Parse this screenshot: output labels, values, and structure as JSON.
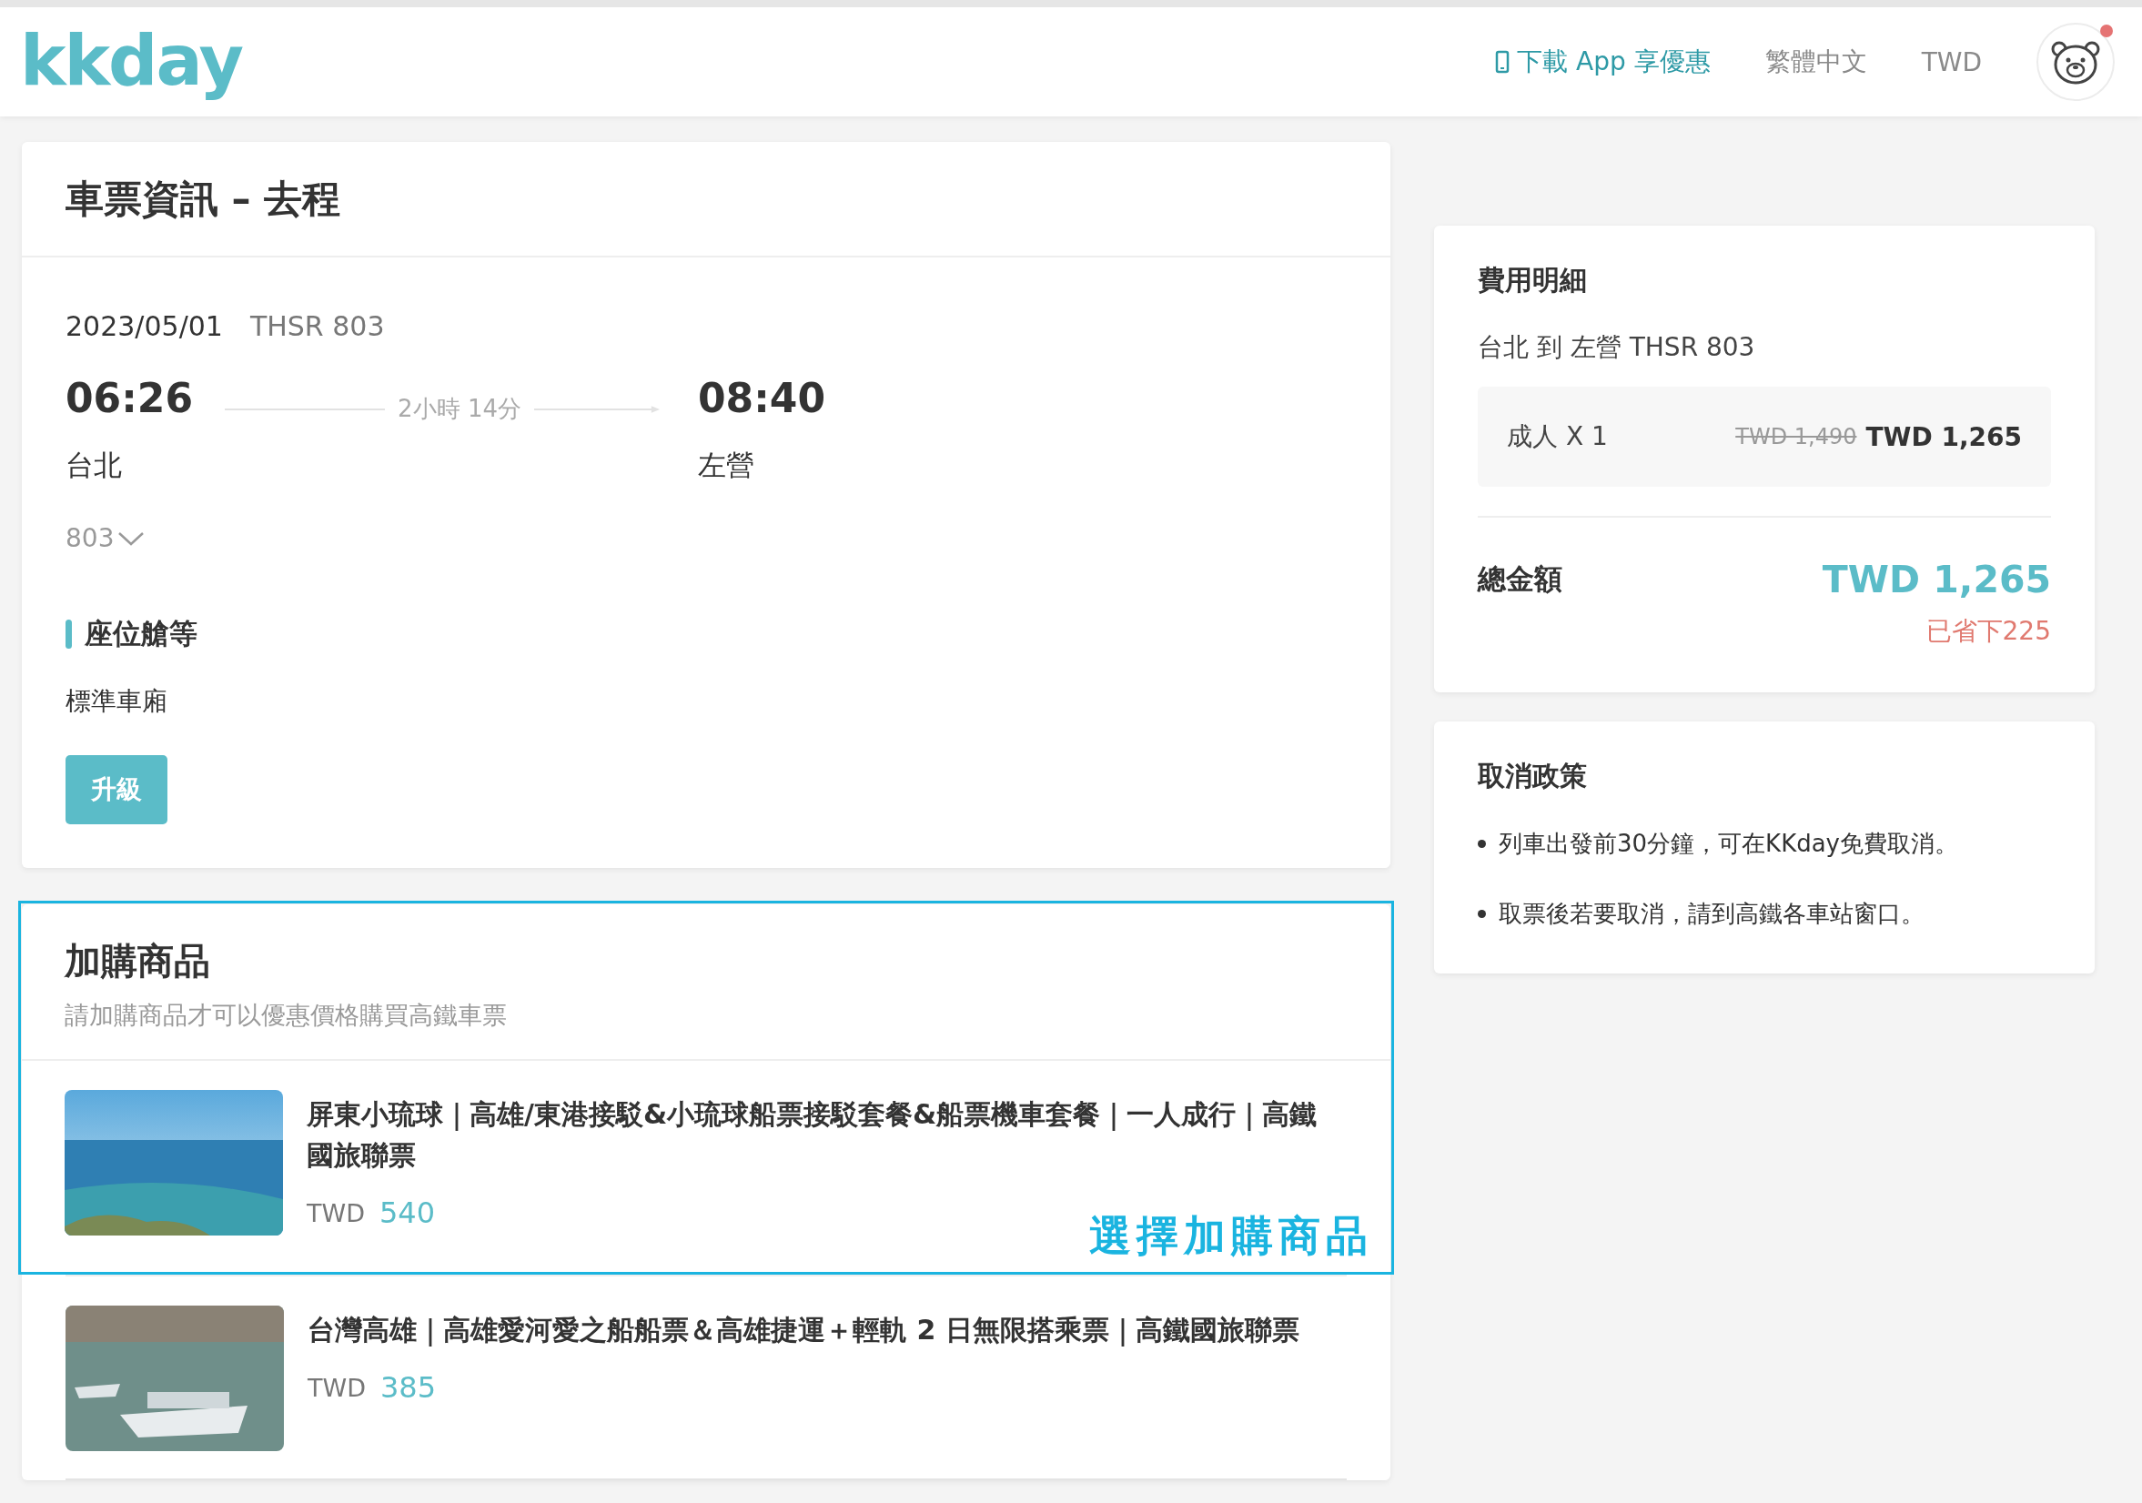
{
  "header": {
    "logo": "kkday",
    "links": [
      {
        "kind": "app",
        "text": "下載 App 享優惠"
      },
      {
        "kind": "plain",
        "text": "繁體中文"
      },
      {
        "kind": "plain",
        "text": "TWD"
      }
    ],
    "avatar": {
      "notification": true
    }
  },
  "ticket": {
    "title": "車票資訊 – 去程",
    "date": "2023/05/01",
    "train": "THSR 803",
    "departure": {
      "time": "06:26",
      "station": "台北"
    },
    "duration": "2小時 14分",
    "arrival": {
      "time": "08:40",
      "station": "左營"
    },
    "stops_toggle": {
      "label": "803",
      "expanded": false
    },
    "seat_heading": "座位艙等",
    "seat_class": "標準車廂",
    "upgrade_button": "升級"
  },
  "addons": {
    "title": "加購商品",
    "subtitle": "請加購商品才可以優惠價格購買高鐵車票",
    "highlight_label": "選擇加購商品",
    "items": [
      {
        "title": "屏東小琉球｜高雄/東港接駁&小琉球船票接駁套餐&船票機車套餐｜一人成行｜高鐵國旅聯票",
        "currency": "TWD",
        "price": "540",
        "highlighted": true
      },
      {
        "title": "台灣高雄｜高雄愛河愛之船船票＆高雄捷運＋輕軌 2 日無限搭乘票｜高鐵國旅聯票",
        "currency": "TWD",
        "price": "385",
        "highlighted": false
      }
    ]
  },
  "fees": {
    "title": "費用明細",
    "route": "台北 到 左營 THSR 803",
    "line": {
      "label": "成人 X 1",
      "original_price": "TWD 1,490",
      "price": "TWD 1,265"
    },
    "total_label": "總金額",
    "total": "TWD 1,265",
    "saved": "已省下225"
  },
  "cancellation": {
    "title": "取消政策",
    "items": [
      "列車出發前30分鐘，可在KKday免費取消。",
      "取票後若要取消，請到高鐵各車站窗口。"
    ]
  }
}
